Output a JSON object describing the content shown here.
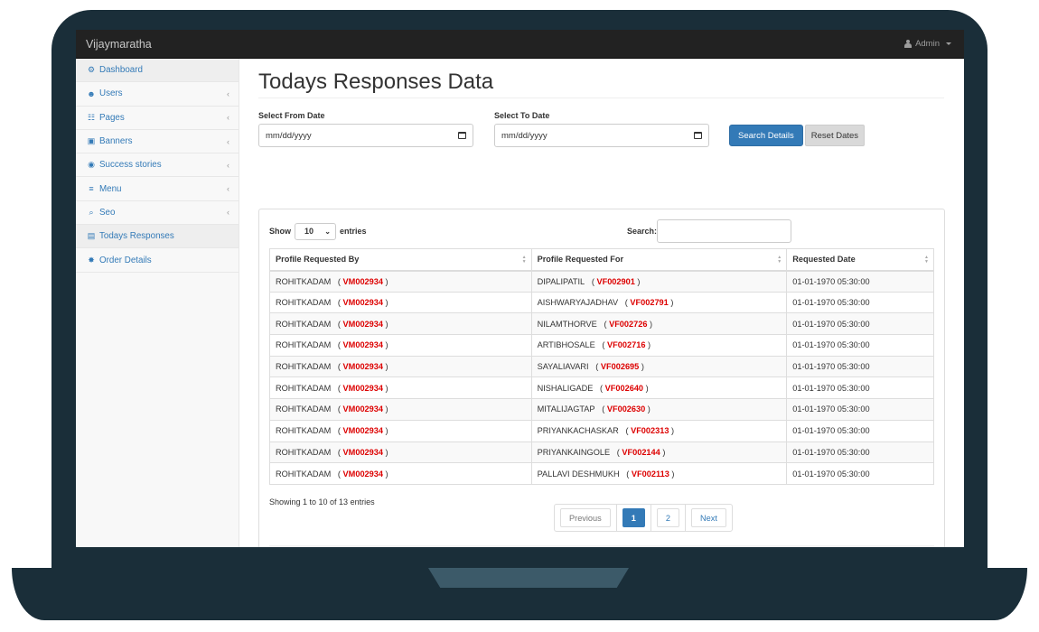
{
  "app": {
    "brand": "Vijaymaratha",
    "user_label": "Admin"
  },
  "sidebar": {
    "items": [
      {
        "label": "Dashboard",
        "icon": "dashboard-icon",
        "glyph": "⚙",
        "chevron": false
      },
      {
        "label": "Users",
        "icon": "users-icon",
        "glyph": "☻",
        "chevron": true
      },
      {
        "label": "Pages",
        "icon": "file-icon",
        "glyph": "☷",
        "chevron": true
      },
      {
        "label": "Banners",
        "icon": "image-icon",
        "glyph": "▣",
        "chevron": true
      },
      {
        "label": "Success stories",
        "icon": "eye-icon",
        "glyph": "◉",
        "chevron": true
      },
      {
        "label": "Menu",
        "icon": "bars-icon",
        "glyph": "≡",
        "chevron": true
      },
      {
        "label": "Seo",
        "icon": "search-icon",
        "glyph": "⌕",
        "chevron": true
      },
      {
        "label": "Todays Responses",
        "icon": "id-card-icon",
        "glyph": "▤",
        "chevron": false
      },
      {
        "label": "Order Details",
        "icon": "gear-icon",
        "glyph": "✸",
        "chevron": false
      }
    ],
    "chevron_glyph": "‹"
  },
  "page": {
    "title": "Todays Responses Data",
    "from_label": "Select From Date",
    "to_label": "Select To Date",
    "from_placeholder": "mm/dd/yyyy",
    "to_placeholder": "mm/dd/yyyy",
    "search_button": "Search Details",
    "reset_button": "Reset Dates"
  },
  "table": {
    "show_label": "Show",
    "entries_label": "entries",
    "page_length": "10",
    "search_label": "Search:",
    "search_value": "",
    "columns": [
      "Profile Requested By",
      "Profile Requested For",
      "Requested Date"
    ],
    "rows": [
      {
        "by_name": "ROHITKADAM",
        "by_code": "VM002934",
        "for_name": "DIPALIPATIL",
        "for_code": "VF002901",
        "date": "01-01-1970 05:30:00"
      },
      {
        "by_name": "ROHITKADAM",
        "by_code": "VM002934",
        "for_name": "AISHWARYAJADHAV",
        "for_code": "VF002791",
        "date": "01-01-1970 05:30:00"
      },
      {
        "by_name": "ROHITKADAM",
        "by_code": "VM002934",
        "for_name": "NILAMTHORVE",
        "for_code": "VF002726",
        "date": "01-01-1970 05:30:00"
      },
      {
        "by_name": "ROHITKADAM",
        "by_code": "VM002934",
        "for_name": "ARTIBHOSALE",
        "for_code": "VF002716",
        "date": "01-01-1970 05:30:00"
      },
      {
        "by_name": "ROHITKADAM",
        "by_code": "VM002934",
        "for_name": "SAYALIAVARI",
        "for_code": "VF002695",
        "date": "01-01-1970 05:30:00"
      },
      {
        "by_name": "ROHITKADAM",
        "by_code": "VM002934",
        "for_name": "NISHALIGADE",
        "for_code": "VF002640",
        "date": "01-01-1970 05:30:00"
      },
      {
        "by_name": "ROHITKADAM",
        "by_code": "VM002934",
        "for_name": "MITALIJAGTAP",
        "for_code": "VF002630",
        "date": "01-01-1970 05:30:00"
      },
      {
        "by_name": "ROHITKADAM",
        "by_code": "VM002934",
        "for_name": "PRIYANKACHASKAR",
        "for_code": "VF002313",
        "date": "01-01-1970 05:30:00"
      },
      {
        "by_name": "ROHITKADAM",
        "by_code": "VM002934",
        "for_name": "PRIYANKAINGOLE",
        "for_code": "VF002144",
        "date": "01-01-1970 05:30:00"
      },
      {
        "by_name": "ROHITKADAM",
        "by_code": "VM002934",
        "for_name": "PALLAVI DESHMUKH",
        "for_code": "VF002113",
        "date": "01-01-1970 05:30:00"
      }
    ],
    "info": "Showing 1 to 10 of 13 entries",
    "pagination": {
      "previous": "Previous",
      "pages": [
        "1",
        "2"
      ],
      "current": "1",
      "next": "Next"
    }
  },
  "colors": {
    "accent": "#337ab7",
    "code_red": "#dd0000",
    "frame": "#1a2e39",
    "topbar": "#222222"
  }
}
